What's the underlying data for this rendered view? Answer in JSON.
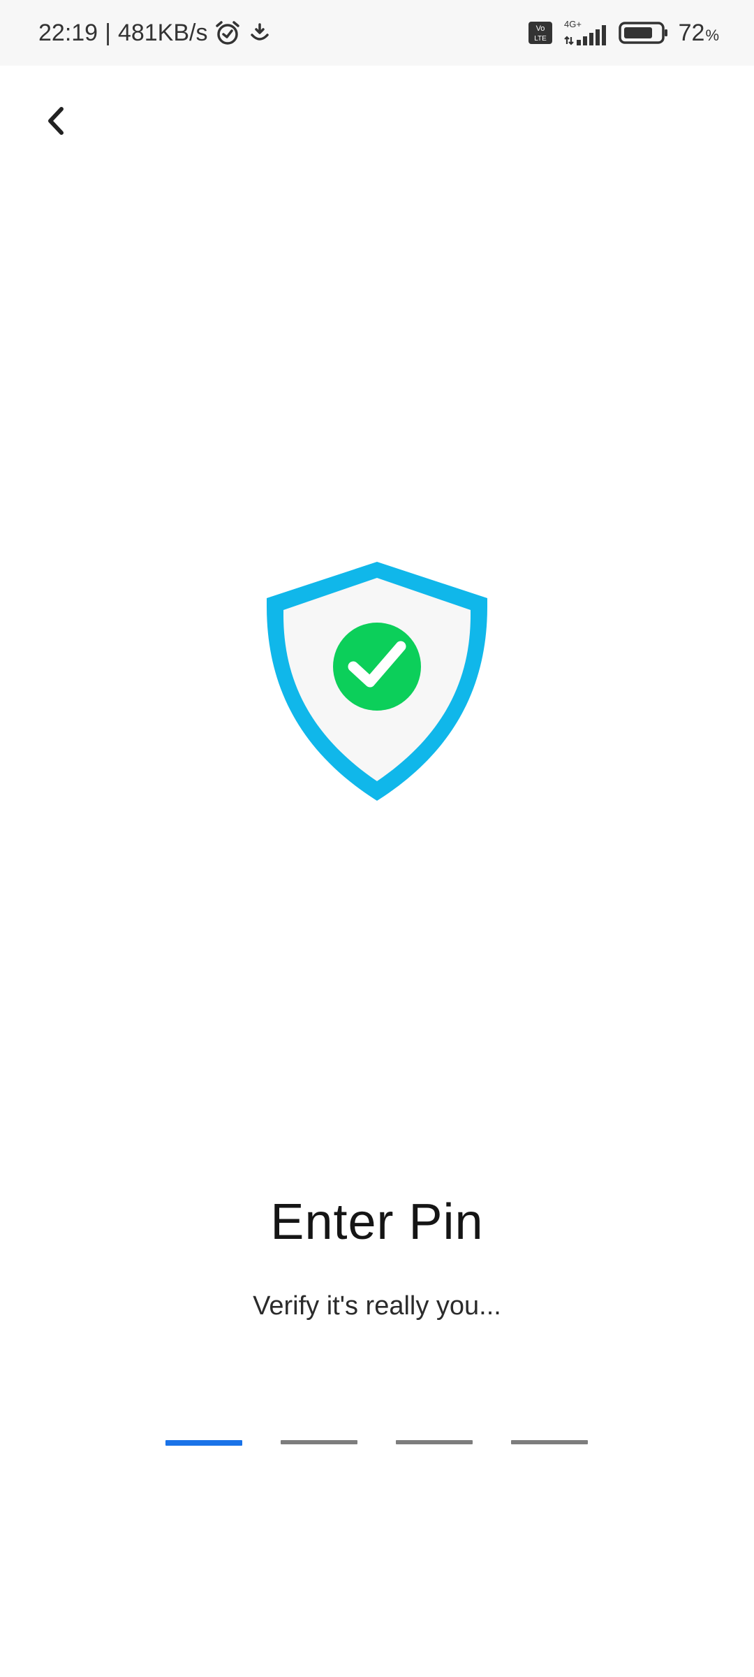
{
  "status_bar": {
    "time": "22:19",
    "network_speed": "481KB/s",
    "separator": "|",
    "icons": [
      "alarm-icon",
      "download-icon",
      "volte-icon",
      "signal-icon",
      "battery-icon"
    ],
    "network_type": "4G+",
    "volte_label_top": "Vo",
    "volte_label_bottom": "LTE",
    "battery_percent": "72",
    "battery_unit": "%"
  },
  "header": {
    "back_icon": "chevron-left-icon"
  },
  "hero": {
    "icon": "shield-check-icon",
    "shield_color": "#10b7ea",
    "check_color": "#0ccf5a"
  },
  "main": {
    "title": "Enter Pin",
    "subtitle": "Verify it's really you..."
  },
  "pin": {
    "length": 4,
    "active_index": 0,
    "active_color": "#1a73e8",
    "inactive_color": "#7d7d7d"
  }
}
